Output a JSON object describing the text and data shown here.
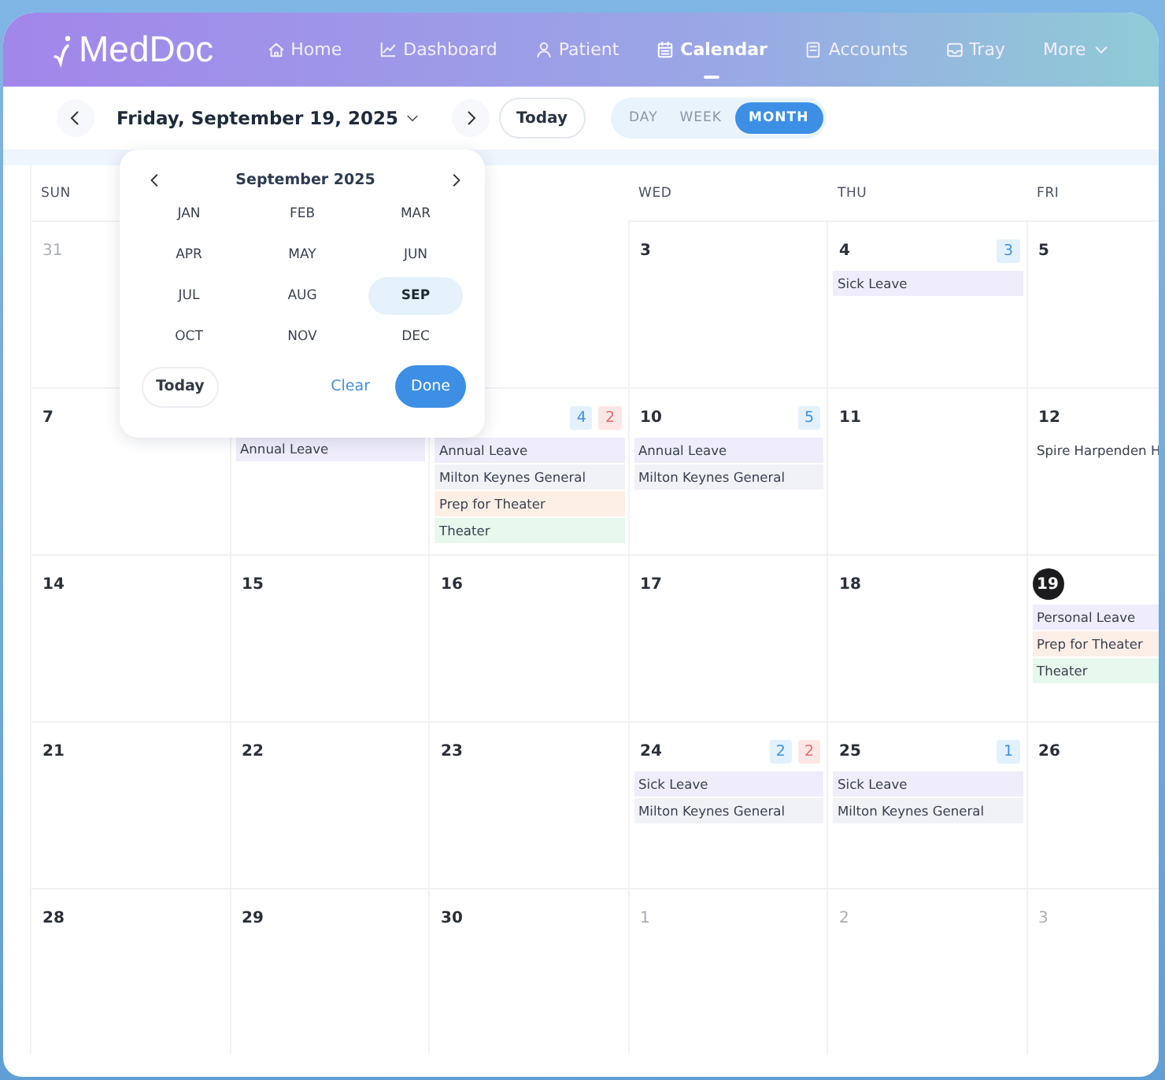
{
  "nav": {
    "logo": "MedDoc",
    "items": [
      {
        "label": "Home",
        "kind": "home",
        "selected": false
      },
      {
        "label": "Dashboard",
        "kind": "chart",
        "selected": false
      },
      {
        "label": "Patient",
        "kind": "person",
        "selected": false
      },
      {
        "label": "Calendar",
        "kind": "calendar",
        "selected": true
      },
      {
        "label": "Accounts",
        "kind": "document",
        "selected": false
      },
      {
        "label": "Tray",
        "kind": "tray",
        "selected": false
      },
      {
        "label": "More",
        "kind": "more",
        "selected": false
      }
    ]
  },
  "toolbar": {
    "date": "Friday, September 19, 2025",
    "today": "Today",
    "views": [
      {
        "label": "DAY",
        "selected": false
      },
      {
        "label": "WEEK",
        "selected": false
      },
      {
        "label": "MONTH",
        "selected": true
      }
    ]
  },
  "calendar": {
    "weekdays": {
      "sun": "SUN",
      "wed": "WED",
      "thu": "THU",
      "fri": "FRI"
    },
    "weeks": [
      {
        "sun": {
          "day": "31",
          "other_month": true,
          "today": false
        },
        "wed": {
          "day": "3",
          "other_month": false,
          "today": false
        },
        "thu": {
          "day": "4",
          "other_month": false,
          "today": false,
          "badges": [
            {
              "text": "3",
              "kind": "info"
            }
          ],
          "events": [
            {
              "label": "Sick Leave",
              "color": "#efedfb"
            }
          ]
        },
        "fri": {
          "day": "5",
          "other_month": false,
          "today": false
        }
      },
      {
        "sun": {
          "day": "7",
          "other_month": false,
          "today": false
        },
        "mon": {
          "events": [
            {
              "label": "Annual Leave",
              "color": "#efedfb"
            }
          ]
        },
        "tue": {
          "badges": [
            {
              "text": "4",
              "kind": "info"
            },
            {
              "text": "2",
              "kind": "alert"
            }
          ],
          "events": [
            {
              "label": "Annual Leave",
              "color": "#efedfb"
            },
            {
              "label": "Milton Keynes General",
              "color": "#f1f2f6"
            },
            {
              "label": "Prep for Theater",
              "color": "#fdefe6"
            },
            {
              "label": "Theater",
              "color": "#e7f8ec"
            }
          ]
        },
        "wed": {
          "day": "10",
          "other_month": false,
          "today": false,
          "badges": [
            {
              "text": "5",
              "kind": "info"
            }
          ],
          "events": [
            {
              "label": "Annual Leave",
              "color": "#efedfb"
            },
            {
              "label": "Milton Keynes General",
              "color": "#f1f2f6"
            }
          ]
        },
        "thu": {
          "day": "11",
          "other_month": false,
          "today": false
        },
        "fri": {
          "day": "12",
          "other_month": false,
          "today": false,
          "events": [
            {
              "label": "Spire Harpenden H",
              "color": "#ffffff"
            }
          ]
        }
      },
      {
        "sun": {
          "day": "14",
          "other_month": false,
          "today": false
        },
        "mon": {
          "day": "15",
          "other_month": false,
          "today": false
        },
        "tue": {
          "day": "16",
          "other_month": false,
          "today": false
        },
        "wed": {
          "day": "17",
          "other_month": false,
          "today": false
        },
        "thu": {
          "day": "18",
          "other_month": false,
          "today": false
        },
        "fri": {
          "day": "19",
          "other_month": false,
          "today": true,
          "events": [
            {
              "label": "Personal Leave",
              "color": "#efedfb"
            },
            {
              "label": "Prep for Theater",
              "color": "#fdefe6"
            },
            {
              "label": "Theater",
              "color": "#e7f8ec"
            }
          ]
        }
      },
      {
        "sun": {
          "day": "21",
          "other_month": false,
          "today": false
        },
        "mon": {
          "day": "22",
          "other_month": false,
          "today": false
        },
        "tue": {
          "day": "23",
          "other_month": false,
          "today": false
        },
        "wed": {
          "day": "24",
          "other_month": false,
          "today": false,
          "badges": [
            {
              "text": "2",
              "kind": "info"
            },
            {
              "text": "2",
              "kind": "alert"
            }
          ],
          "events": [
            {
              "label": "Sick Leave",
              "color": "#efedfb"
            },
            {
              "label": "Milton Keynes General",
              "color": "#f1f2f6"
            }
          ]
        },
        "thu": {
          "day": "25",
          "other_month": false,
          "today": false,
          "badges": [
            {
              "text": "1",
              "kind": "info"
            }
          ],
          "events": [
            {
              "label": "Sick Leave",
              "color": "#efedfb"
            },
            {
              "label": "Milton Keynes General",
              "color": "#f1f2f6"
            }
          ]
        },
        "fri": {
          "day": "26",
          "other_month": false,
          "today": false
        }
      },
      {
        "sun": {
          "day": "28",
          "other_month": false,
          "today": false
        },
        "mon": {
          "day": "29",
          "other_month": false,
          "today": false
        },
        "tue": {
          "day": "30",
          "other_month": false,
          "today": false
        },
        "wed": {
          "day": "1",
          "other_month": true,
          "today": false
        },
        "thu": {
          "day": "2",
          "other_month": true,
          "today": false
        },
        "fri": {
          "day": "3",
          "other_month": true,
          "today": false
        }
      }
    ]
  },
  "month_picker": {
    "title": "September 2025",
    "months": [
      {
        "label": "JAN",
        "selected": false
      },
      {
        "label": "FEB",
        "selected": false
      },
      {
        "label": "MAR",
        "selected": false
      },
      {
        "label": "APR",
        "selected": false
      },
      {
        "label": "MAY",
        "selected": false
      },
      {
        "label": "JUN",
        "selected": false
      },
      {
        "label": "JUL",
        "selected": false
      },
      {
        "label": "AUG",
        "selected": false
      },
      {
        "label": "SEP",
        "selected": true
      },
      {
        "label": "OCT",
        "selected": false
      },
      {
        "label": "NOV",
        "selected": false
      },
      {
        "label": "DEC",
        "selected": false
      }
    ],
    "today": "Today",
    "clear": "Clear",
    "done": "Done"
  }
}
